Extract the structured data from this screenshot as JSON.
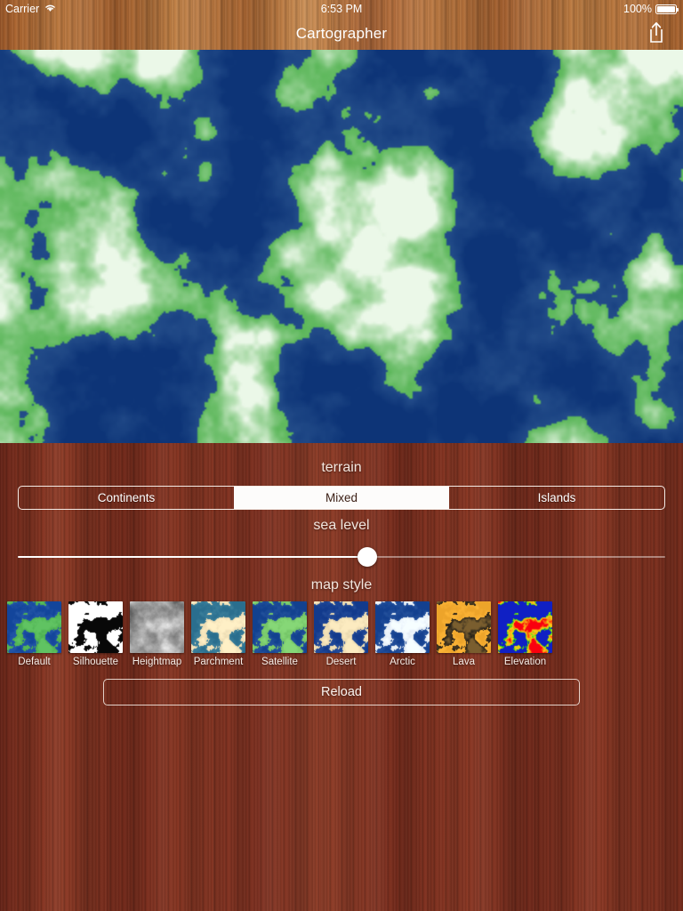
{
  "status_bar": {
    "carrier": "Carrier",
    "wifi_icon": "wifi-icon",
    "time": "6:53 PM",
    "battery_percent": "100%",
    "battery_icon": "battery-full-icon"
  },
  "nav_bar": {
    "title": "Cartographer",
    "share_icon": "share-icon"
  },
  "map": {
    "ocean_color": "#0d3477",
    "land_color": "#5cb75a",
    "highland_color": "#e8f5e4"
  },
  "controls": {
    "terrain": {
      "label": "terrain",
      "options": [
        {
          "label": "Continents",
          "selected": false
        },
        {
          "label": "Mixed",
          "selected": true
        },
        {
          "label": "Islands",
          "selected": false
        }
      ]
    },
    "sea_level": {
      "label": "sea level",
      "value_percent": 54
    },
    "map_style": {
      "label": "map style",
      "selected_index": 0,
      "items": [
        {
          "label": "Default",
          "ocean": "#13459b",
          "land": "#4caf50",
          "accent": "#4caf50"
        },
        {
          "label": "Silhouette",
          "ocean": "#ffffff",
          "land": "#000000",
          "accent": "#000000"
        },
        {
          "label": "Heightmap",
          "ocean": "#8c8c8c",
          "land": "#c9c9c9",
          "accent": "#9a9a9a"
        },
        {
          "label": "Parchment",
          "ocean": "#2a6e8e",
          "land": "#ecdcb4",
          "accent": "#ecdcb4"
        },
        {
          "label": "Satellite",
          "ocean": "#12418f",
          "land": "#72c365",
          "accent": "#72c365"
        },
        {
          "label": "Desert",
          "ocean": "#123a8c",
          "land": "#e8d7ae",
          "accent": "#e8d7ae"
        },
        {
          "label": "Arctic",
          "ocean": "#13408f",
          "land": "#e2eaf2",
          "accent": "#e2eaf2"
        },
        {
          "label": "Lava",
          "ocean": "#eda42a",
          "land": "#1d1a16",
          "accent": "#eda42a"
        },
        {
          "label": "Elevation",
          "ocean": "#1020cc",
          "land": "#18d318",
          "accent": "#f03000"
        }
      ]
    },
    "reload": {
      "label": "Reload"
    }
  }
}
